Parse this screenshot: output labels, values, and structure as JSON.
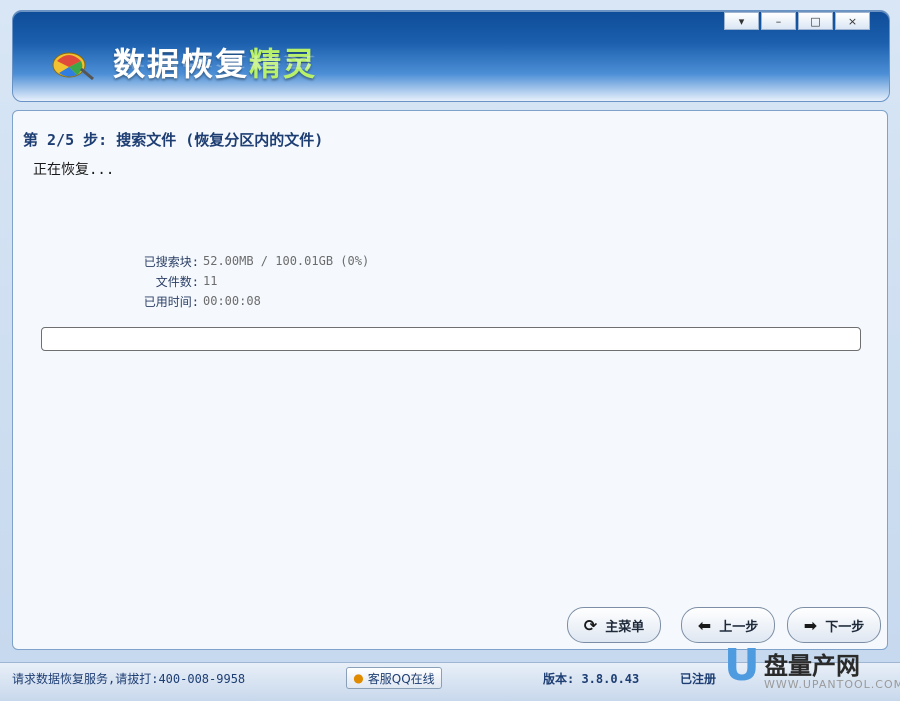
{
  "window": {
    "title_main": "数据恢复",
    "title_accent": "精灵",
    "controls": [
      "▾",
      "–",
      "□",
      "×"
    ]
  },
  "step": {
    "title": "第 2/5 步: 搜索文件 (恢复分区内的文件)",
    "status": "正在恢复..."
  },
  "stats": [
    {
      "label": "已搜索块:",
      "value": "52.00MB / 100.01GB (0%)"
    },
    {
      "label": "文件数:",
      "value": "11"
    },
    {
      "label": "已用时间:",
      "value": "00:00:08"
    }
  ],
  "progress": {
    "percent": 0
  },
  "buttons": {
    "main_menu": "主菜单",
    "prev": "上一步",
    "next": "下一步"
  },
  "footer": {
    "hotline": "请求数据恢复服务,请拔打:400-008-9958",
    "qq": "客服QQ在线",
    "version": "版本: 3.8.0.43",
    "registered": "已注册"
  },
  "watermark": {
    "letter": "U",
    "brand": "盘量产网",
    "url": "WWW.UPANTOOL.COM"
  }
}
